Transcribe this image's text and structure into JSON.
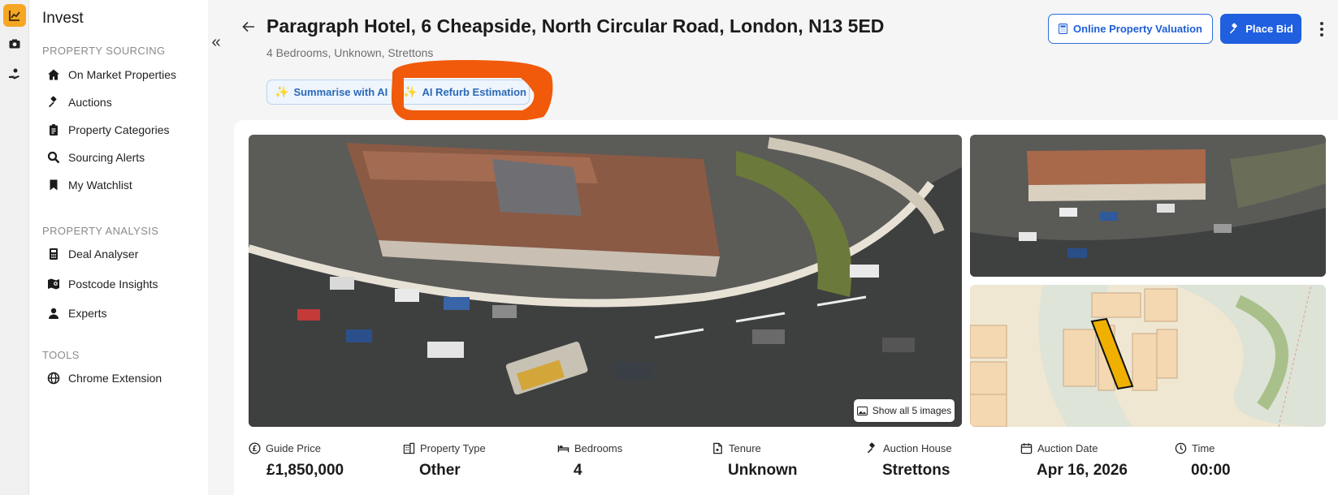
{
  "app": {
    "title": "Invest"
  },
  "sidebar": {
    "sections": [
      {
        "label": "PROPERTY SOURCING",
        "items": [
          {
            "label": "On Market Properties",
            "icon": "home-icon"
          },
          {
            "label": "Auctions",
            "icon": "gavel-icon"
          },
          {
            "label": "Property Categories",
            "icon": "clipboard-icon"
          },
          {
            "label": "Sourcing Alerts",
            "icon": "search-icon"
          },
          {
            "label": "My Watchlist",
            "icon": "bookmark-icon"
          }
        ]
      },
      {
        "label": "PROPERTY ANALYSIS",
        "items": [
          {
            "label": "Deal Analyser",
            "icon": "calculator-icon"
          },
          {
            "label": "Postcode Insights",
            "icon": "map-pin-icon"
          },
          {
            "label": "Experts",
            "icon": "person-icon"
          }
        ]
      },
      {
        "label": "TOOLS",
        "items": [
          {
            "label": "Chrome Extension",
            "icon": "globe-icon"
          }
        ]
      }
    ]
  },
  "header": {
    "title": "Paragraph Hotel, 6 Cheapside, North Circular Road, London, N13 5ED",
    "subtitle": "4 Bedrooms, Unknown, Strettons",
    "valuation_label": "Online Property Valuation",
    "bid_label": "Place Bid"
  },
  "ai_actions": {
    "summarise_label": "Summarise with AI",
    "refurb_label": "AI Refurb Estimation"
  },
  "gallery": {
    "show_all_label": "Show all 5 images"
  },
  "facts": [
    {
      "label": "Guide Price",
      "value": "£1,850,000",
      "icon": "pound-icon"
    },
    {
      "label": "Property Type",
      "value": "Other",
      "icon": "building-icon"
    },
    {
      "label": "Bedrooms",
      "value": "4",
      "icon": "bed-icon"
    },
    {
      "label": "Tenure",
      "value": "Unknown",
      "icon": "document-icon"
    },
    {
      "label": "Auction House",
      "value": "Strettons",
      "icon": "gavel-icon"
    },
    {
      "label": "Auction Date",
      "value": "Apr 16, 2026",
      "icon": "calendar-icon"
    },
    {
      "label": "Time",
      "value": "00:00",
      "icon": "clock-icon"
    }
  ],
  "colors": {
    "accent": "#f5a623",
    "primary": "#1f5fe0",
    "annotation": "#f05a0a"
  }
}
